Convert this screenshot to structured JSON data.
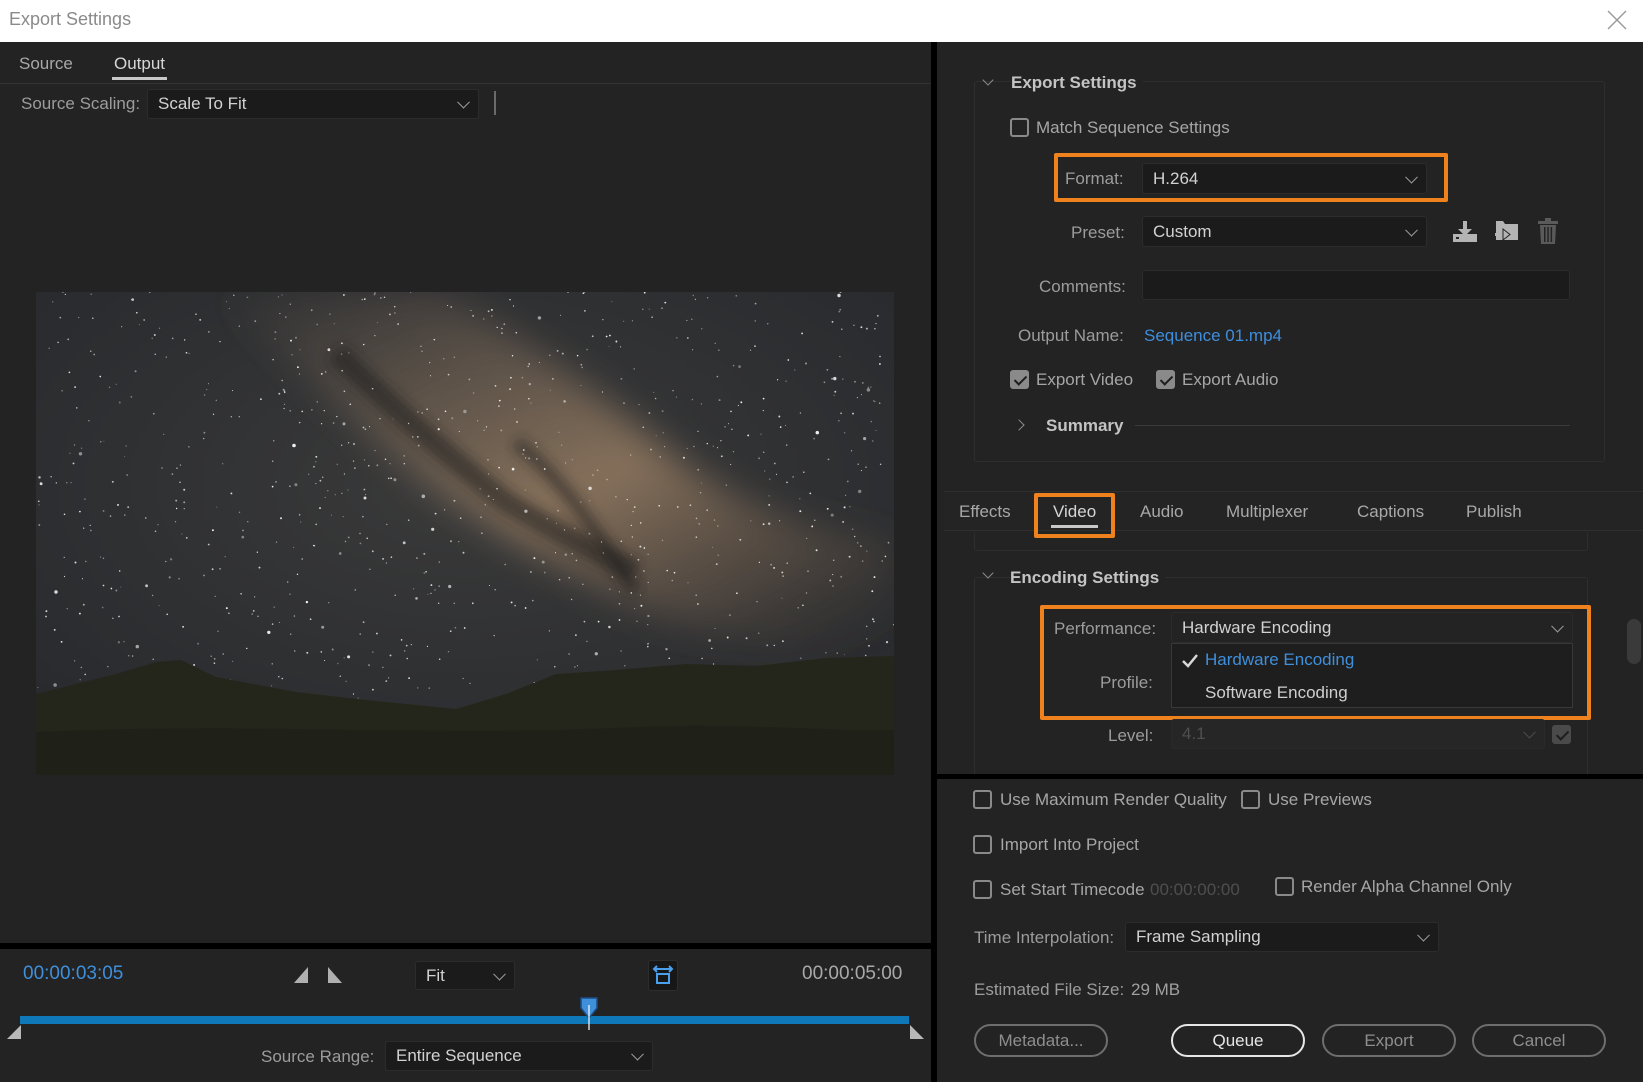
{
  "window": {
    "title": "Export Settings",
    "close_icon": "close-x-icon"
  },
  "left": {
    "tabs": [
      {
        "label": "Source",
        "active": false
      },
      {
        "label": "Output",
        "active": true
      }
    ],
    "source_scaling": {
      "label": "Source Scaling:",
      "value": "Scale To Fit"
    },
    "preview": {
      "description": "Milky Way night sky over dark hills"
    },
    "playback": {
      "current_timecode": "00:00:03:05",
      "duration_timecode": "00:00:05:00",
      "zoom_value": "Fit",
      "set_in_icon": "mark-in-icon",
      "set_out_icon": "mark-out-icon",
      "aspect_icon": "aspect-ratio-correction-icon",
      "playhead_position": 0.64
    },
    "source_range": {
      "label": "Source Range:",
      "value": "Entire Sequence"
    }
  },
  "export_settings": {
    "section_title": "Export Settings",
    "match_sequence": {
      "label": "Match Sequence Settings",
      "checked": false
    },
    "format": {
      "label": "Format:",
      "value": "H.264"
    },
    "preset": {
      "label": "Preset:",
      "value": "Custom"
    },
    "preset_icons": [
      "save-preset-icon",
      "import-preset-icon",
      "delete-preset-icon"
    ],
    "comments": {
      "label": "Comments:",
      "value": ""
    },
    "output_name": {
      "label": "Output Name:",
      "value": "Sequence 01.mp4"
    },
    "export_video": {
      "label": "Export Video",
      "checked": true
    },
    "export_audio": {
      "label": "Export Audio",
      "checked": true
    },
    "summary": {
      "label": "Summary",
      "expanded": false
    }
  },
  "settings_tabs": [
    {
      "label": "Effects",
      "active": false
    },
    {
      "label": "Video",
      "active": true
    },
    {
      "label": "Audio",
      "active": false
    },
    {
      "label": "Multiplexer",
      "active": false
    },
    {
      "label": "Captions",
      "active": false
    },
    {
      "label": "Publish",
      "active": false
    }
  ],
  "encoding": {
    "section_title": "Encoding Settings",
    "performance": {
      "label": "Performance:",
      "value": "Hardware Encoding",
      "options": [
        {
          "label": "Hardware Encoding",
          "selected": true
        },
        {
          "label": "Software Encoding",
          "selected": false
        }
      ]
    },
    "profile": {
      "label": "Profile:"
    },
    "level": {
      "label": "Level:",
      "value": "4.1",
      "disabled": true
    }
  },
  "bottom": {
    "use_max_render_quality": {
      "label": "Use Maximum Render Quality",
      "checked": false
    },
    "use_previews": {
      "label": "Use Previews",
      "checked": false
    },
    "import_into_project": {
      "label": "Import Into Project",
      "checked": false
    },
    "set_start_timecode": {
      "label": "Set Start Timecode",
      "checked": false,
      "value": "00:00:00:00"
    },
    "render_alpha_only": {
      "label": "Render Alpha Channel Only",
      "checked": false
    },
    "time_interpolation": {
      "label": "Time Interpolation:",
      "value": "Frame Sampling"
    },
    "estimated_file_size": {
      "label": "Estimated File Size:",
      "value": "29 MB"
    },
    "buttons": {
      "metadata": "Metadata...",
      "queue": "Queue",
      "export": "Export",
      "cancel": "Cancel"
    }
  },
  "colors": {
    "accent_blue": "#3f8fdb",
    "highlight_orange": "#f0821e",
    "timeline_blue": "#0f78b8",
    "panel_bg": "#232323"
  }
}
